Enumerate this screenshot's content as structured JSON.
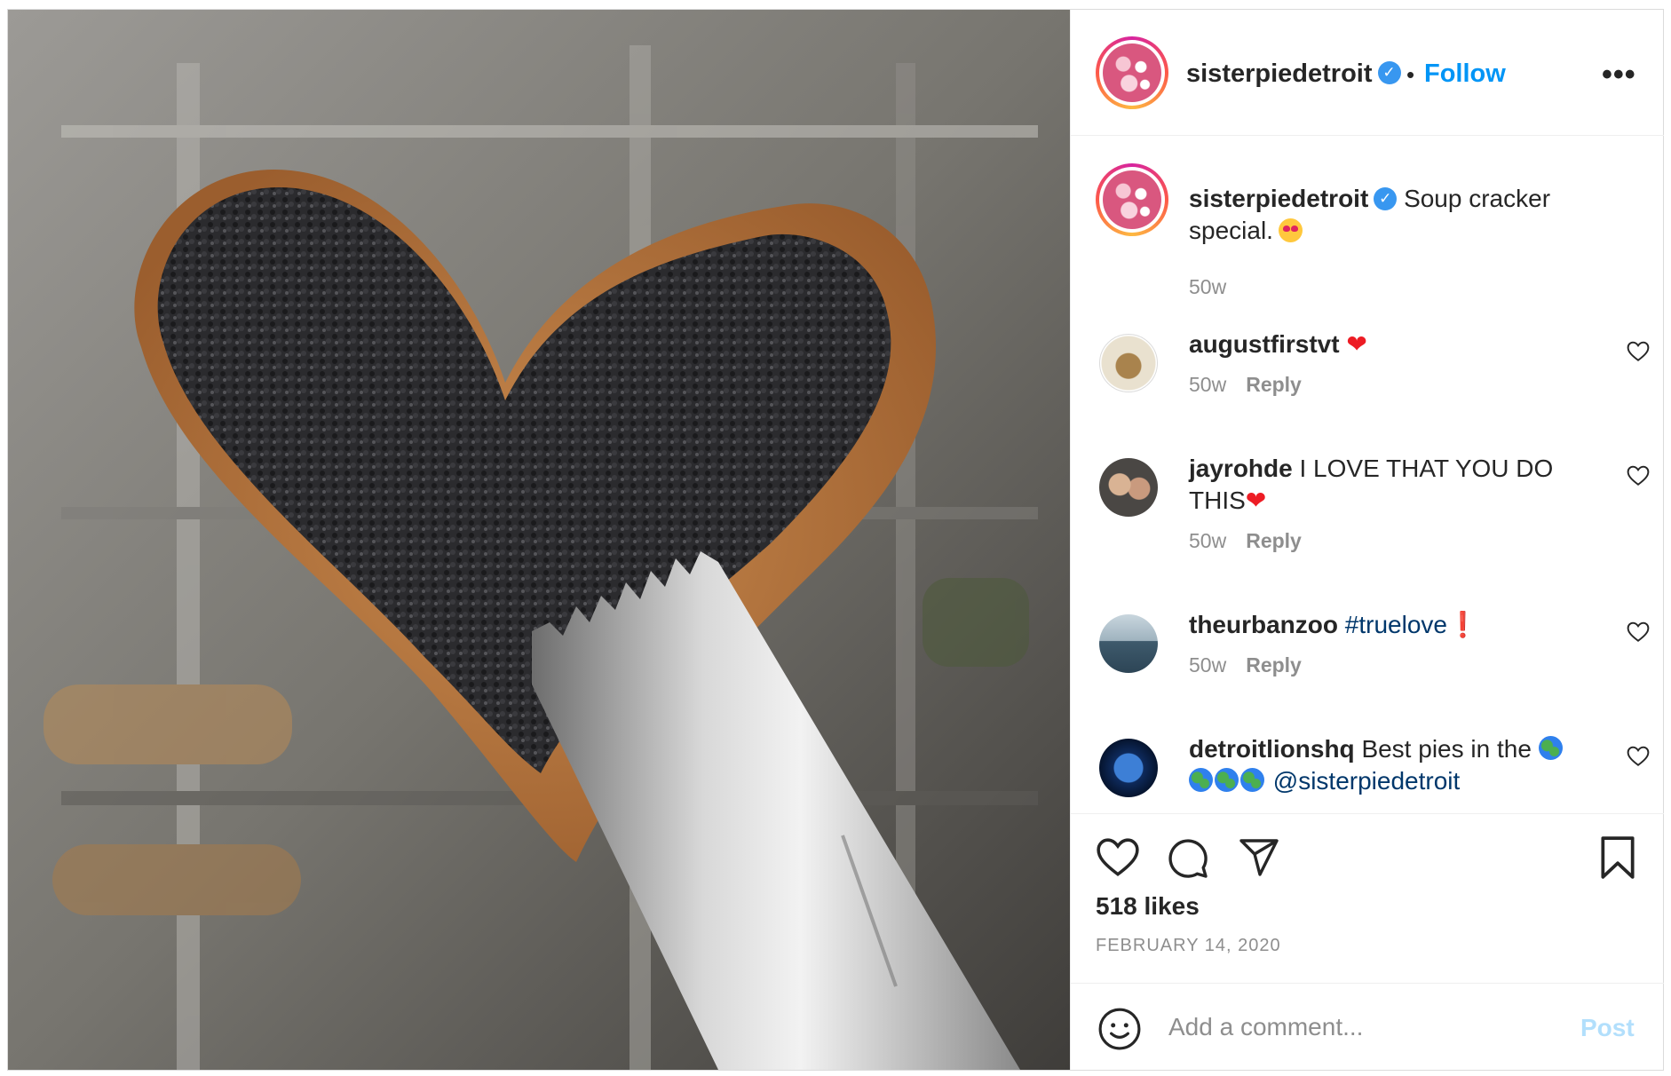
{
  "post": {
    "author": "sisterpiedetroit",
    "follow_label": "Follow",
    "separator": "•",
    "more_label": "•••"
  },
  "caption": {
    "username": "sisterpiedetroit",
    "text": "Soup cracker special.",
    "time": "50w"
  },
  "comments": [
    {
      "username": "augustfirstvt",
      "text": "",
      "time": "50w",
      "reply_label": "Reply"
    },
    {
      "username": "jayrohde",
      "text": "I LOVE THAT YOU DO THIS",
      "time": "50w",
      "reply_label": "Reply"
    },
    {
      "username": "theurbanzoo",
      "text": "#truelove",
      "time": "50w",
      "reply_label": "Reply"
    },
    {
      "username": "detroitlionshq",
      "text": "Best pies in the",
      "mention": "@sisterpiedetroit"
    }
  ],
  "stats": {
    "likes": "518 likes",
    "date": "FEBRUARY 14, 2020"
  },
  "comment_box": {
    "placeholder": "Add a comment...",
    "post_label": "Post"
  },
  "colors": {
    "link_blue": "#0095f6",
    "verified_blue": "#3897f0",
    "hashtag_navy": "#00376b",
    "post_disabled": "#b2dffc",
    "muted_gray": "#8e8e8e"
  },
  "icons": [
    "verified-badge-icon",
    "more-options-icon",
    "heart-outline-icon",
    "comment-icon",
    "share-icon",
    "bookmark-icon",
    "smiley-icon"
  ]
}
